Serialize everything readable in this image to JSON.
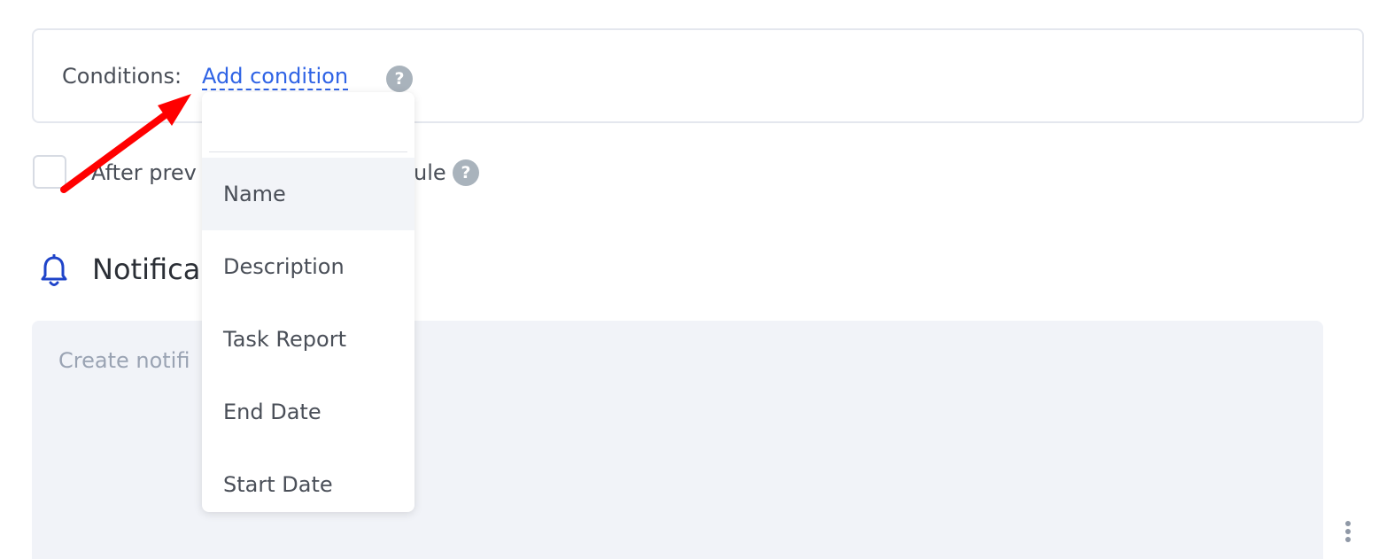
{
  "conditions": {
    "label": "Conditions:",
    "add_link": "Add condition",
    "help": "?"
  },
  "after_previous": {
    "label_visible_start": "After prev",
    "label_visible_end": "ule",
    "help": "?"
  },
  "notifications": {
    "title_visible": "Notifica",
    "placeholder_visible": "Create notifi"
  },
  "dropdown": {
    "search_placeholder": "",
    "items": [
      {
        "label": "Name",
        "active": true
      },
      {
        "label": "Description",
        "active": false
      },
      {
        "label": "Task Report",
        "active": false
      },
      {
        "label": "End Date",
        "active": false
      },
      {
        "label": "Start Date",
        "active": false
      }
    ]
  },
  "colors": {
    "link": "#2f63e5",
    "annotation_arrow": "#ff0000",
    "bell": "#1f44c9"
  },
  "icons": [
    "help-icon",
    "bell-icon",
    "kebab-menu-icon"
  ]
}
